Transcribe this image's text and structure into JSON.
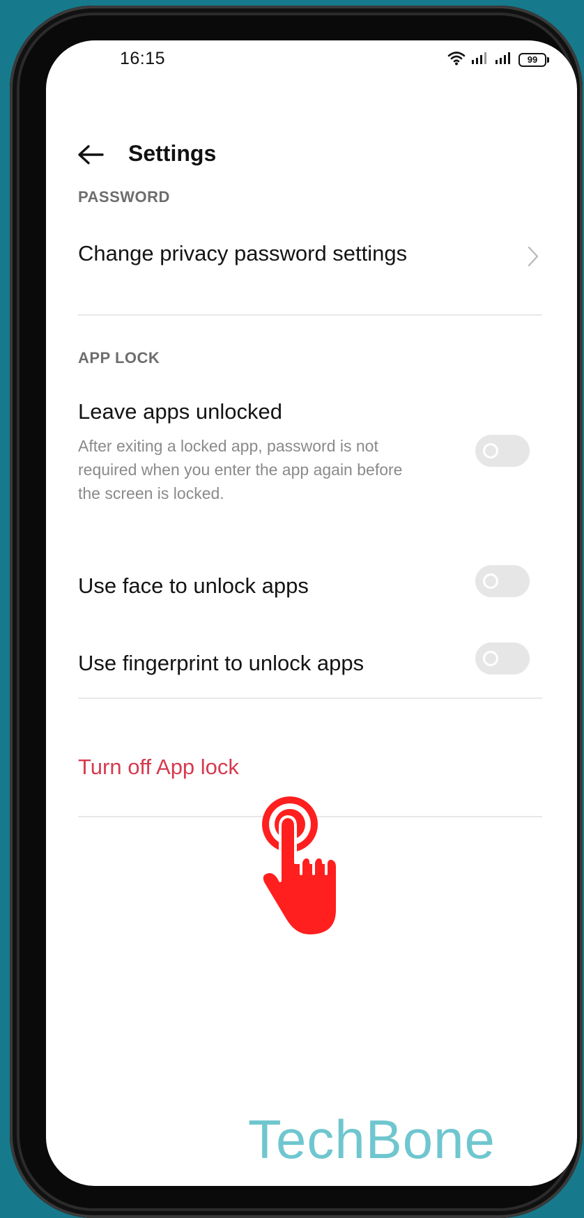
{
  "status_bar": {
    "time": "16:15",
    "battery_level": "99"
  },
  "header": {
    "title": "Settings"
  },
  "sections": {
    "password": {
      "header": "PASSWORD",
      "change_password_label": "Change privacy password settings"
    },
    "app_lock": {
      "header": "APP LOCK",
      "leave_unlocked": {
        "title": "Leave apps unlocked",
        "description": "After exiting a locked app, password is not required when you enter the app again before the screen is locked.",
        "enabled": false
      },
      "face_unlock": {
        "title": "Use face to unlock apps",
        "enabled": false
      },
      "fingerprint_unlock": {
        "title": "Use fingerprint to unlock apps",
        "enabled": false
      }
    },
    "turn_off": {
      "label": "Turn off App lock"
    }
  },
  "watermark": "TechBone",
  "colors": {
    "background": "#167a8c",
    "danger": "#d63a4f",
    "toggle_off": "#e6e6e6",
    "watermark": "#6fc6cf",
    "tap_indicator": "#ff1f1f"
  }
}
